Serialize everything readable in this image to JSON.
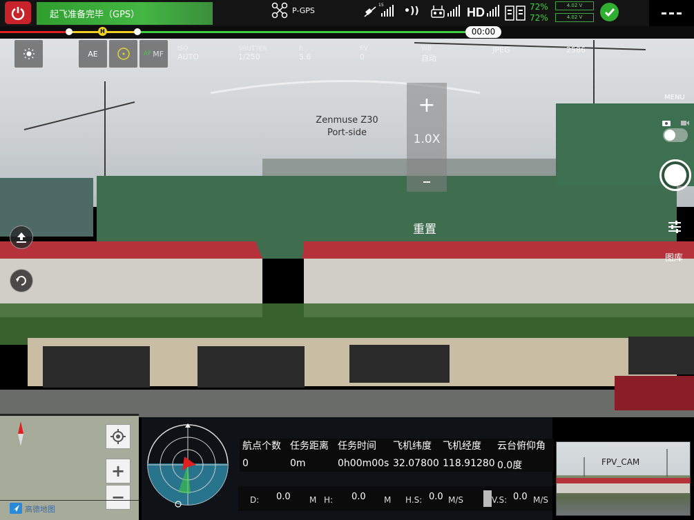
{
  "status_banner": "起飞准备完毕（GPS）",
  "gps_mode": "P-GPS",
  "satellite_count": "15",
  "hd_label": "HD",
  "battery": {
    "pct1": "72%",
    "pct2": "72%",
    "volt1": "4.02 V",
    "volt2": "4.02 V"
  },
  "flight_time": "00:00",
  "toolbar": {
    "ae_label": "AE",
    "mf_label": "MF"
  },
  "camera_params": [
    {
      "key": "ISO",
      "value": "AUTO"
    },
    {
      "key": "SHUTTER",
      "value": "1/250"
    },
    {
      "key": "F",
      "value": "5.6"
    },
    {
      "key": "EV",
      "value": "0"
    },
    {
      "key": "WB",
      "value": "自动"
    },
    {
      "key": "",
      "value": "JPEG"
    },
    {
      "key": "",
      "value": "2586"
    }
  ],
  "camera_name": "Zenmuse Z30",
  "camera_position": "Port-side",
  "zoom": {
    "plus": "+",
    "value": "1.0X"
  },
  "reset_label": "重置",
  "menu_label": "MENU",
  "gallery_label": "图库",
  "map_label": "高德地图",
  "telemetry": {
    "headers": [
      "航点个数",
      "任务距离",
      "任务时间",
      "飞机纬度",
      "飞机经度",
      "云台俯仰角"
    ],
    "values": [
      "0",
      "0m",
      "0h00m00s",
      "32.07800",
      "118.91280",
      "0.0度"
    ]
  },
  "flight": {
    "d_label": "D:",
    "d_value": "0.0",
    "d_unit": "M",
    "h_label": "H:",
    "h_value": "0.0",
    "h_unit": "M",
    "hs_label": "H.S:",
    "hs_value": "0.0",
    "hs_unit": "M/S",
    "vs_label": "V.S:",
    "vs_value": "0.0",
    "vs_unit": "M/S"
  },
  "fpv_label": "FPV_CAM",
  "colors": {
    "ok_green": "#2fae2f",
    "banner_green": "#43b643",
    "alert_red": "#c8232a",
    "progress_yellow": "#f0d020"
  }
}
